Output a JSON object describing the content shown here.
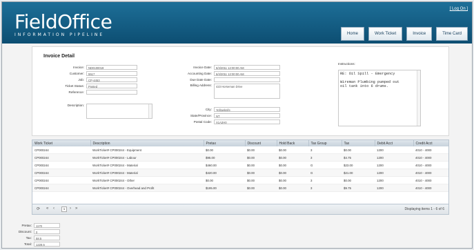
{
  "header": {
    "logout": "[ Log On ]",
    "logo_main": "Field",
    "logo_office": "Office",
    "tagline": "INFORMATION PIPELINE",
    "nav": [
      "Home",
      "Work Ticket",
      "Invoice",
      "Time Card"
    ]
  },
  "invoice": {
    "title": "Invoice Detail",
    "left": [
      {
        "label": "Invoice:",
        "value": "ND0100019"
      },
      {
        "label": "Customer:",
        "value": "5517"
      },
      {
        "label": "Job:",
        "value": "CP-4453"
      },
      {
        "label": "Ticket Status:",
        "value": "Posted"
      },
      {
        "label": "Reference:",
        "value": ""
      }
    ],
    "description_label": "Description:",
    "description_value": "",
    "middle": [
      {
        "label": "Invoice Date:",
        "value": "6/4/2011 12:00:00 AM"
      },
      {
        "label": "Accounting Date:",
        "value": "6/4/2011 12:00:00 AM"
      },
      {
        "label": "Due Date Date:",
        "value": ""
      },
      {
        "label": "Billing Address:",
        "value": "423 Horseman Drive"
      }
    ],
    "middle_lower": [
      {
        "label": "City:",
        "value": "Yellowknife"
      },
      {
        "label": "State/Province:",
        "value": "NT"
      },
      {
        "label": "Postal Code:",
        "value": "X1A2H0"
      }
    ],
    "instructions_label": "Instructions:",
    "instructions_text": "RE: Oil Spill - Emergency\n\nWireman Plumbing pumped out\noil tank into 6 drums."
  },
  "grid": {
    "columns": [
      "Work Ticket",
      "Description",
      "Pretax",
      "Discount",
      "Hold Back",
      "Tax Group",
      "Tax",
      "Debit Acct",
      "Credit Acct"
    ],
    "rows": [
      [
        "CP000244",
        "WorkTicket# CP000244 - Equipment",
        "$0.00",
        "$0.00",
        "$0.00",
        "3",
        "$0.00",
        "1200",
        "4010 - 4000"
      ],
      [
        "CP000244",
        "WorkTicket# CP000244 - Labour",
        "$95.00",
        "$0.00",
        "$0.00",
        "3",
        "$4.75",
        "1200",
        "4010 - 4000"
      ],
      [
        "CP000244",
        "WorkTicket# CP000244 - Material",
        "$460.00",
        "$0.00",
        "$0.00",
        "G",
        "$23.00",
        "1200",
        "4010 - 4000"
      ],
      [
        "CP000244",
        "WorkTicket# CP000244 - Material",
        "$420.00",
        "$0.00",
        "$0.00",
        "G",
        "$21.00",
        "1200",
        "4010 - 4000"
      ],
      [
        "CP000244",
        "WorkTicket# CP000244 - Other",
        "$0.00",
        "$0.00",
        "$0.00",
        "3",
        "$0.00",
        "1200",
        "4010 - 4000"
      ],
      [
        "CP000244",
        "WorkTicket# CP000244 - Overhead and Profit",
        "$195.00",
        "$0.00",
        "$0.00",
        "3",
        "$9.75",
        "1200",
        "4010 - 4000"
      ]
    ],
    "page": "1",
    "displaying": "Displaying items 1 - 6 of 6"
  },
  "totals": [
    {
      "label": "Pretax:",
      "value": "1170"
    },
    {
      "label": "Discount:",
      "value": "0"
    },
    {
      "label": "Tax:",
      "value": "58.5"
    },
    {
      "label": "Total:",
      "value": "1228.5"
    }
  ]
}
